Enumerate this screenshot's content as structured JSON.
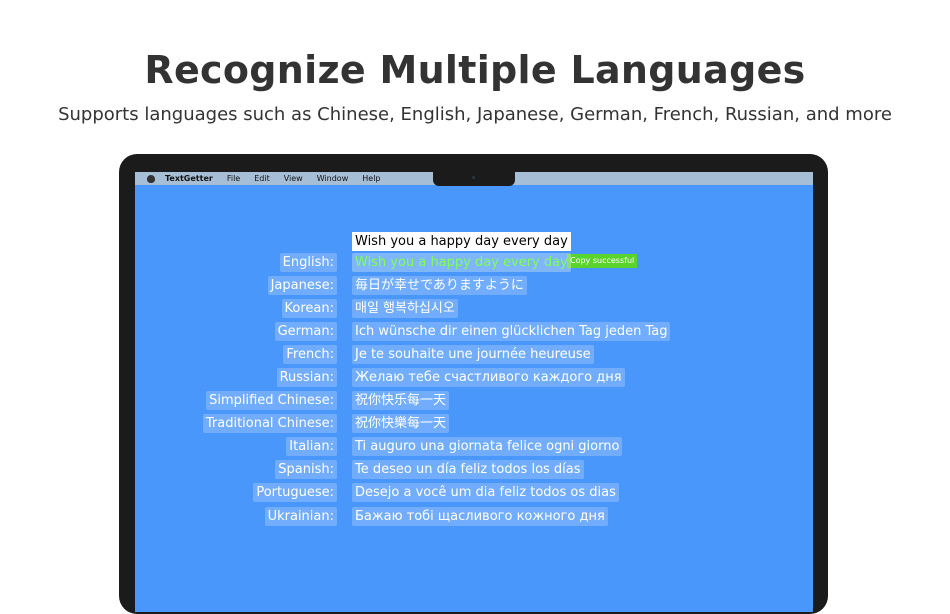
{
  "hero": {
    "title": "Recognize Multiple Languages",
    "subtitle": "Supports languages such as Chinese, English, Japanese, German, French, Russian, and more"
  },
  "menubar": {
    "app_name": "TextGetter",
    "items": [
      "File",
      "Edit",
      "View",
      "Window",
      "Help"
    ]
  },
  "source_text": "Wish you a happy day every day",
  "copy_status": "Copy successful",
  "translations": [
    {
      "label": "English:",
      "text": "Wish you a happy day every day"
    },
    {
      "label": "Japanese:",
      "text": "毎日が幸せでありますように"
    },
    {
      "label": "Korean:",
      "text": "매일 행복하십시오"
    },
    {
      "label": "German:",
      "text": "Ich wünsche dir einen glücklichen Tag jeden Tag"
    },
    {
      "label": "French:",
      "text": "Je te souhaite une journée heureuse"
    },
    {
      "label": "Russian:",
      "text": "Желаю тебе счастливого каждого дня"
    },
    {
      "label": "Simplified Chinese:",
      "text": "祝你快乐每一天"
    },
    {
      "label": "Traditional Chinese:",
      "text": "祝你快樂每一天"
    },
    {
      "label": "Italian:",
      "text": "Ti auguro una giornata felice ogni giorno"
    },
    {
      "label": "Spanish:",
      "text": "Te deseo un día feliz todos los días"
    },
    {
      "label": "Portuguese:",
      "text": "Desejo a você um dia feliz todos os dias"
    },
    {
      "label": "Ukrainian:",
      "text": "Бажаю тобі щасливого кожного дня"
    }
  ],
  "colors": {
    "screen": "#4a97fb",
    "copy_badge": "#5bd32d",
    "highlight_text": "#7dff57"
  }
}
